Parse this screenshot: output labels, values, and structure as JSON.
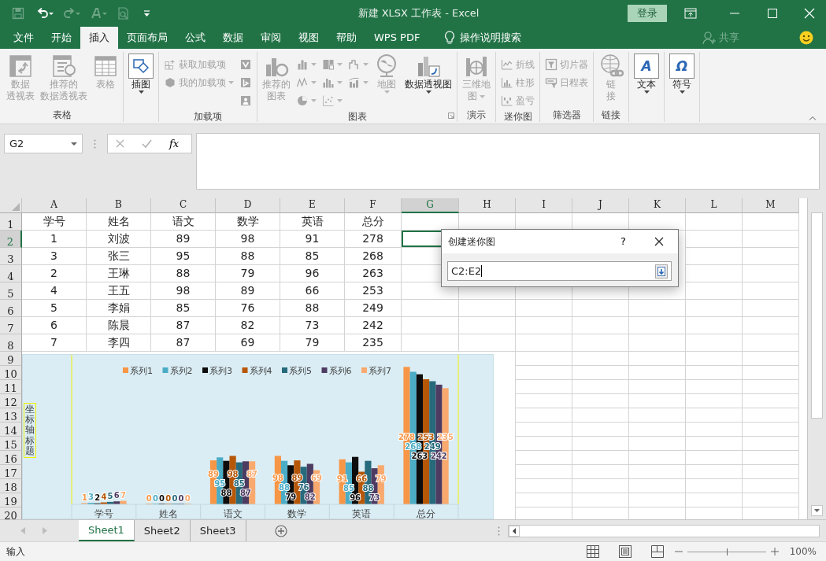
{
  "window": {
    "title": "新建 XLSX 工作表 - Excel",
    "sign_in": "登录"
  },
  "quick_access": [
    {
      "kind": "save",
      "disabled": true
    },
    {
      "kind": "undo",
      "disabled": false
    },
    {
      "kind": "redo",
      "disabled": true
    },
    {
      "kind": "touch",
      "disabled": true
    },
    {
      "kind": "preview",
      "disabled": true
    },
    {
      "kind": "customize",
      "disabled": false
    }
  ],
  "ribbon_tabs": [
    {
      "label": "文件",
      "selected": false
    },
    {
      "label": "开始",
      "selected": false
    },
    {
      "label": "插入",
      "selected": true
    },
    {
      "label": "页面布局",
      "selected": false
    },
    {
      "label": "公式",
      "selected": false
    },
    {
      "label": "数据",
      "selected": false
    },
    {
      "label": "审阅",
      "selected": false
    },
    {
      "label": "视图",
      "selected": false
    },
    {
      "label": "帮助",
      "selected": false
    },
    {
      "label": "WPS PDF",
      "selected": false
    }
  ],
  "tell_me": "操作说明搜索",
  "share": {
    "label": "共享",
    "disabled": true
  },
  "ribbon_groups": [
    {
      "label": "表格",
      "columns": [
        [
          {
            "kind": "pivottable",
            "label": [
              "数据",
              "透视表"
            ],
            "disabled": true,
            "dropdown": false
          }
        ],
        [
          {
            "kind": "recommendedpivot",
            "label": [
              "推荐的",
              "数据透视表"
            ],
            "disabled": true,
            "dropdown": false
          }
        ],
        [
          {
            "kind": "table",
            "label": "表格",
            "disabled": true,
            "dropdown": false
          }
        ]
      ]
    },
    {
      "columns": [
        [
          {
            "kind": "illustrations",
            "label": "插图",
            "disabled": false,
            "dropdown": true
          }
        ]
      ]
    },
    {
      "label": "加载项",
      "columns": [
        [
          {
            "kind": "getaddins",
            "label": "获取加载项",
            "disabled": true,
            "dropdown": false
          },
          {
            "kind": "myaddins",
            "label": "我的加载项",
            "disabled": true,
            "dropdown": true
          }
        ],
        [
          {
            "kind": "visio",
            "disabled": true,
            "dropdown": false
          },
          {
            "kind": "bing",
            "disabled": true,
            "dropdown": false
          },
          {
            "kind": "peoplegraph",
            "disabled": true,
            "dropdown": false
          }
        ]
      ]
    },
    {
      "label": "图表",
      "launcher": true,
      "columns": [
        [
          {
            "kind": "recommendedcharts",
            "label": [
              "推荐的",
              "图表"
            ],
            "disabled": true,
            "dropdown": false
          }
        ],
        [
          {
            "kind": "column",
            "disabled": true,
            "dropdown": true
          },
          {
            "kind": "line",
            "disabled": true,
            "dropdown": true
          },
          {
            "kind": "pie",
            "disabled": true,
            "dropdown": true
          }
        ],
        [
          {
            "kind": "treemap",
            "disabled": true,
            "dropdown": true
          },
          {
            "kind": "statistic",
            "disabled": true,
            "dropdown": true
          },
          {
            "kind": "scatter",
            "disabled": true,
            "dropdown": true
          }
        ],
        [
          {
            "kind": "waterfall",
            "disabled": true,
            "dropdown": true
          },
          {
            "kind": "combo",
            "disabled": true,
            "dropdown": true
          }
        ],
        [
          {
            "kind": "map",
            "label": "地图",
            "disabled": true,
            "dropdown": true
          }
        ],
        [
          {
            "kind": "pivotchart",
            "label": "数据透视图",
            "disabled": false,
            "dropdown": true
          }
        ]
      ]
    },
    {
      "label": "演示",
      "columns": [
        [
          {
            "kind": "map3d",
            "label": [
              "三维地",
              "图"
            ],
            "disabled": true,
            "dropdown": true
          }
        ]
      ]
    },
    {
      "label": "迷你图",
      "columns": [
        [
          {
            "kind": "sparkline",
            "label": "折线",
            "disabled": true,
            "dropdown": false
          },
          {
            "kind": "sparkcolumn",
            "label": "柱形",
            "disabled": true,
            "dropdown": false
          },
          {
            "kind": "winloss",
            "label": "盈亏",
            "disabled": true,
            "dropdown": false
          }
        ]
      ]
    },
    {
      "label": "筛选器",
      "columns": [
        [
          {
            "kind": "slicer",
            "label": "切片器",
            "disabled": true,
            "dropdown": false
          },
          {
            "kind": "timeline",
            "label": "日程表",
            "disabled": true,
            "dropdown": false
          }
        ]
      ]
    },
    {
      "label": "链接",
      "columns": [
        [
          {
            "kind": "link",
            "label": [
              "链",
              "接"
            ],
            "disabled": true,
            "dropdown": false
          }
        ]
      ]
    },
    {
      "columns": [
        [
          {
            "kind": "text",
            "glyph": "A",
            "label": "文本",
            "disabled": false,
            "dropdown": true
          }
        ]
      ]
    },
    {
      "columns": [
        [
          {
            "kind": "symbol",
            "glyph": "Ω",
            "label": "符号",
            "disabled": false,
            "dropdown": true
          }
        ]
      ]
    }
  ],
  "formula_bar": {
    "name_box": "G2",
    "fx": "fx"
  },
  "sheet": {
    "columns": [
      {
        "label": "A",
        "selected": false
      },
      {
        "label": "B",
        "selected": false
      },
      {
        "label": "C",
        "selected": false
      },
      {
        "label": "D",
        "selected": false
      },
      {
        "label": "E",
        "selected": false
      },
      {
        "label": "F",
        "selected": false
      },
      {
        "label": "G",
        "selected": true
      },
      {
        "label": "H",
        "selected": false
      },
      {
        "label": "I",
        "selected": false
      },
      {
        "label": "J",
        "selected": false
      },
      {
        "label": "K",
        "selected": false
      },
      {
        "label": "L",
        "selected": false
      },
      {
        "label": "M",
        "selected": false
      }
    ],
    "rows": [
      {
        "label": "1",
        "selected": false,
        "cells": [
          "学号",
          "姓名",
          "语文",
          "数学",
          "英语",
          "总分"
        ]
      },
      {
        "label": "2",
        "selected": true,
        "cells": [
          "1",
          "刘波",
          "89",
          "98",
          "91",
          "278"
        ]
      },
      {
        "label": "3",
        "selected": false,
        "cells": [
          "3",
          "张三",
          "95",
          "88",
          "85",
          "268"
        ]
      },
      {
        "label": "4",
        "selected": false,
        "cells": [
          "2",
          "王琳",
          "88",
          "79",
          "96",
          "263"
        ]
      },
      {
        "label": "5",
        "selected": false,
        "cells": [
          "4",
          "王五",
          "98",
          "89",
          "66",
          "253"
        ]
      },
      {
        "label": "6",
        "selected": false,
        "cells": [
          "5",
          "李娟",
          "85",
          "76",
          "88",
          "249"
        ]
      },
      {
        "label": "7",
        "selected": false,
        "cells": [
          "6",
          "陈晨",
          "87",
          "82",
          "73",
          "242"
        ]
      },
      {
        "label": "8",
        "selected": false,
        "cells": [
          "7",
          "李四",
          "87",
          "69",
          "79",
          "235"
        ]
      },
      {
        "label": "9",
        "selected": false
      },
      {
        "label": "10",
        "selected": false
      },
      {
        "label": "11",
        "selected": false
      },
      {
        "label": "12",
        "selected": false
      },
      {
        "label": "13",
        "selected": false
      },
      {
        "label": "14",
        "selected": false
      },
      {
        "label": "15",
        "selected": false
      },
      {
        "label": "16",
        "selected": false
      },
      {
        "label": "17",
        "selected": false
      },
      {
        "label": "18",
        "selected": false
      },
      {
        "label": "19",
        "selected": false
      },
      {
        "label": "20",
        "selected": false
      }
    ]
  },
  "chart": {
    "chart_data": {
      "type": "bar",
      "ylabel": "坐标轴标题",
      "categories": [
        "学号",
        "姓名",
        "语文",
        "数学",
        "英语",
        "总分"
      ],
      "data_labels": true,
      "legend": "top",
      "series": [
        {
          "name": "系列1",
          "color": "#f79646",
          "values": [
            1,
            0,
            89,
            98,
            91,
            278
          ]
        },
        {
          "name": "系列2",
          "color": "#4bacc6",
          "values": [
            3,
            0,
            95,
            88,
            85,
            268
          ]
        },
        {
          "name": "系列3",
          "color": "#0d0d0d",
          "values": [
            2,
            0,
            88,
            79,
            96,
            263
          ]
        },
        {
          "name": "系列4",
          "color": "#b65708",
          "values": [
            4,
            0,
            98,
            89,
            66,
            253
          ]
        },
        {
          "name": "系列5",
          "color": "#276a7c",
          "values": [
            5,
            0,
            85,
            76,
            88,
            249
          ]
        },
        {
          "name": "系列6",
          "color": "#4d3b62",
          "values": [
            6,
            0,
            87,
            82,
            73,
            242
          ]
        },
        {
          "name": "系列7",
          "color": "#f9a96e",
          "values": [
            7,
            0,
            87,
            69,
            79,
            235
          ]
        }
      ]
    }
  },
  "dialog": {
    "title": "创建迷你图",
    "help": "?",
    "input_value": "C2:E2"
  },
  "sheet_tabs": [
    {
      "label": "Sheet1",
      "selected": true
    },
    {
      "label": "Sheet2",
      "selected": false
    },
    {
      "label": "Sheet3",
      "selected": false
    }
  ],
  "status_bar": {
    "mode": "输入",
    "zoom": {
      "level": 0.5,
      "reading": "100%"
    }
  }
}
